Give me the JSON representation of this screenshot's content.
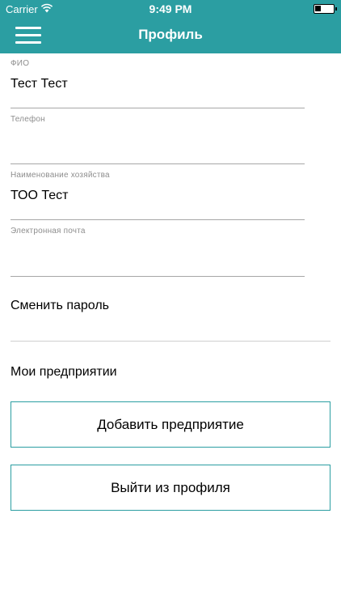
{
  "status_bar": {
    "carrier": "Carrier",
    "time": "9:49 PM",
    "icons": [
      "wifi-icon",
      "battery-icon"
    ]
  },
  "nav": {
    "title": "Профиль",
    "menu_icon": "hamburger-menu-icon"
  },
  "form": {
    "fio": {
      "label": "ФИО",
      "value": "Тест Тест"
    },
    "phone": {
      "label": "Телефон",
      "value": ""
    },
    "farm": {
      "label": "Наименование хозяйства",
      "value": "ТОО Тест"
    },
    "email": {
      "label": "Электронная почта",
      "value": ""
    }
  },
  "change_password": "Сменить пароль",
  "enterprises_title": "Мои предприятии",
  "buttons": {
    "add_enterprise": "Добавить предприятие",
    "logout": "Выйти из профиля"
  },
  "colors": {
    "accent": "#2b9ea2",
    "divider": "#cfcfcf"
  }
}
